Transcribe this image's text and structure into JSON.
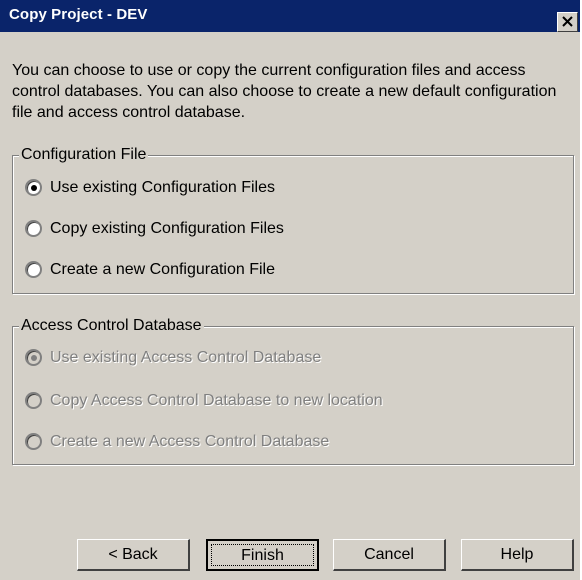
{
  "window": {
    "title": "Copy Project - DEV"
  },
  "intro_text": "You can choose to use or copy the current configuration files and access control databases.  You can also choose to create a new default configuration file and access control database.",
  "config_group": {
    "title": "Configuration File",
    "options": [
      {
        "label": "Use existing Configuration Files",
        "selected": true
      },
      {
        "label": "Copy existing Configuration Files",
        "selected": false
      },
      {
        "label": "Create a new Configuration File",
        "selected": false
      }
    ]
  },
  "acd_group": {
    "title": "Access Control Database",
    "disabled": true,
    "options": [
      {
        "label": "Use existing Access Control Database",
        "selected": true
      },
      {
        "label": "Copy Access Control Database to new location",
        "selected": false
      },
      {
        "label": "Create a new Access Control Database",
        "selected": false
      }
    ]
  },
  "buttons": {
    "back": "< Back",
    "finish": "Finish",
    "cancel": "Cancel",
    "help": "Help"
  },
  "colors": {
    "titlebar": "#0a246a",
    "face": "#d4d0c8",
    "disabled_text": "#808080"
  }
}
